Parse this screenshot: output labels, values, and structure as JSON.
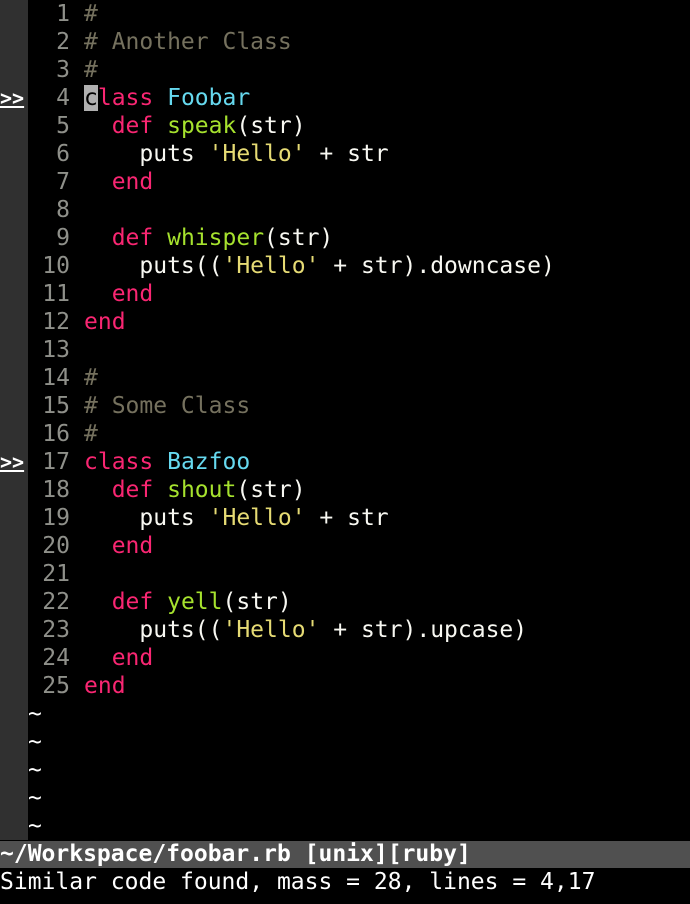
{
  "theme": {
    "comment": "#75715e",
    "keyword": "#f92672",
    "classname": "#66d9ef",
    "method": "#a6e22e",
    "string": "#e6db74",
    "plain": "#f8f8f2",
    "linenumber": "#8f908a",
    "sign_gutter_bg": "#303030",
    "status_bg": "#505050"
  },
  "sign_marker": ">>",
  "lines": [
    {
      "n": "1",
      "sign": false,
      "tokens": [
        {
          "t": "#",
          "c": "comment"
        }
      ]
    },
    {
      "n": "2",
      "sign": false,
      "tokens": [
        {
          "t": "# Another Class",
          "c": "comment"
        }
      ]
    },
    {
      "n": "3",
      "sign": false,
      "tokens": [
        {
          "t": "#",
          "c": "comment"
        }
      ]
    },
    {
      "n": "4",
      "sign": true,
      "tokens": [
        {
          "t": "c",
          "c": "keyword",
          "cursor": true
        },
        {
          "t": "lass",
          "c": "keyword"
        },
        {
          "t": " ",
          "c": "plain"
        },
        {
          "t": "Foobar",
          "c": "classname"
        }
      ]
    },
    {
      "n": "5",
      "sign": false,
      "tokens": [
        {
          "t": "  ",
          "c": "plain"
        },
        {
          "t": "def",
          "c": "keyword"
        },
        {
          "t": " ",
          "c": "plain"
        },
        {
          "t": "speak",
          "c": "method"
        },
        {
          "t": "(str)",
          "c": "plain"
        }
      ]
    },
    {
      "n": "6",
      "sign": false,
      "tokens": [
        {
          "t": "    puts ",
          "c": "plain"
        },
        {
          "t": "'Hello'",
          "c": "string"
        },
        {
          "t": " + str",
          "c": "plain"
        }
      ]
    },
    {
      "n": "7",
      "sign": false,
      "tokens": [
        {
          "t": "  ",
          "c": "plain"
        },
        {
          "t": "end",
          "c": "keyword"
        }
      ]
    },
    {
      "n": "8",
      "sign": false,
      "tokens": []
    },
    {
      "n": "9",
      "sign": false,
      "tokens": [
        {
          "t": "  ",
          "c": "plain"
        },
        {
          "t": "def",
          "c": "keyword"
        },
        {
          "t": " ",
          "c": "plain"
        },
        {
          "t": "whisper",
          "c": "method"
        },
        {
          "t": "(str)",
          "c": "plain"
        }
      ]
    },
    {
      "n": "10",
      "sign": false,
      "tokens": [
        {
          "t": "    puts((",
          "c": "plain"
        },
        {
          "t": "'Hello'",
          "c": "string"
        },
        {
          "t": " + str).downcase)",
          "c": "plain"
        }
      ]
    },
    {
      "n": "11",
      "sign": false,
      "tokens": [
        {
          "t": "  ",
          "c": "plain"
        },
        {
          "t": "end",
          "c": "keyword"
        }
      ]
    },
    {
      "n": "12",
      "sign": false,
      "tokens": [
        {
          "t": "end",
          "c": "keyword"
        }
      ]
    },
    {
      "n": "13",
      "sign": false,
      "tokens": []
    },
    {
      "n": "14",
      "sign": false,
      "tokens": [
        {
          "t": "#",
          "c": "comment"
        }
      ]
    },
    {
      "n": "15",
      "sign": false,
      "tokens": [
        {
          "t": "# Some Class",
          "c": "comment"
        }
      ]
    },
    {
      "n": "16",
      "sign": false,
      "tokens": [
        {
          "t": "#",
          "c": "comment"
        }
      ]
    },
    {
      "n": "17",
      "sign": true,
      "tokens": [
        {
          "t": "class",
          "c": "keyword"
        },
        {
          "t": " ",
          "c": "plain"
        },
        {
          "t": "Bazfoo",
          "c": "classname"
        }
      ]
    },
    {
      "n": "18",
      "sign": false,
      "tokens": [
        {
          "t": "  ",
          "c": "plain"
        },
        {
          "t": "def",
          "c": "keyword"
        },
        {
          "t": " ",
          "c": "plain"
        },
        {
          "t": "shout",
          "c": "method"
        },
        {
          "t": "(str)",
          "c": "plain"
        }
      ]
    },
    {
      "n": "19",
      "sign": false,
      "tokens": [
        {
          "t": "    puts ",
          "c": "plain"
        },
        {
          "t": "'Hello'",
          "c": "string"
        },
        {
          "t": " + str",
          "c": "plain"
        }
      ]
    },
    {
      "n": "20",
      "sign": false,
      "tokens": [
        {
          "t": "  ",
          "c": "plain"
        },
        {
          "t": "end",
          "c": "keyword"
        }
      ]
    },
    {
      "n": "21",
      "sign": false,
      "tokens": []
    },
    {
      "n": "22",
      "sign": false,
      "tokens": [
        {
          "t": "  ",
          "c": "plain"
        },
        {
          "t": "def",
          "c": "keyword"
        },
        {
          "t": " ",
          "c": "plain"
        },
        {
          "t": "yell",
          "c": "method"
        },
        {
          "t": "(str)",
          "c": "plain"
        }
      ]
    },
    {
      "n": "23",
      "sign": false,
      "tokens": [
        {
          "t": "    puts((",
          "c": "plain"
        },
        {
          "t": "'Hello'",
          "c": "string"
        },
        {
          "t": " + str).upcase)",
          "c": "plain"
        }
      ]
    },
    {
      "n": "24",
      "sign": false,
      "tokens": [
        {
          "t": "  ",
          "c": "plain"
        },
        {
          "t": "end",
          "c": "keyword"
        }
      ]
    },
    {
      "n": "25",
      "sign": false,
      "tokens": [
        {
          "t": "end",
          "c": "keyword"
        }
      ]
    }
  ],
  "empty_rows": [
    "~",
    "~",
    "~",
    "~",
    "~"
  ],
  "statusline": "~/Workspace/foobar.rb [unix][ruby]",
  "message": "Similar code found, mass = 28, lines = 4,17"
}
